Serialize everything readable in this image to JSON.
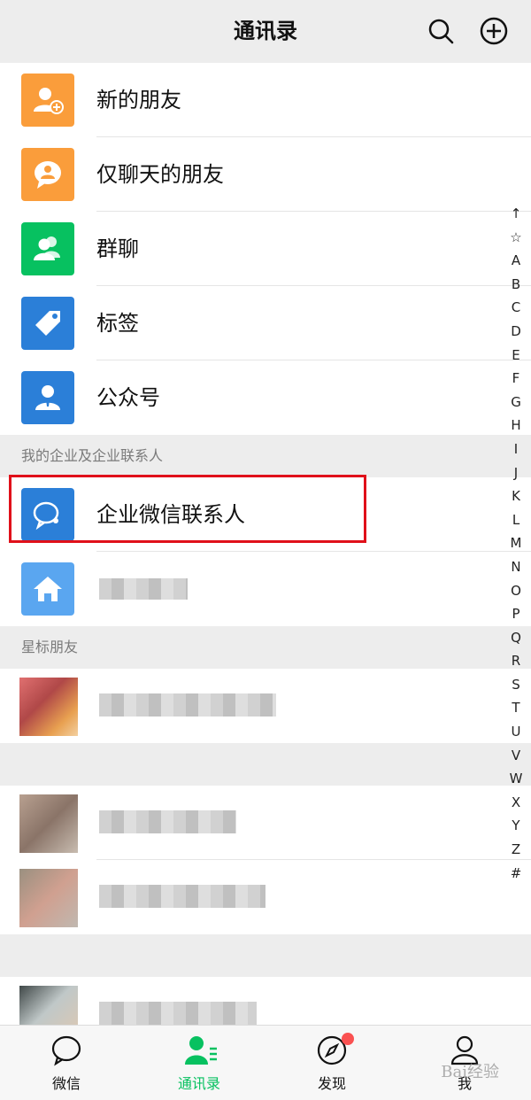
{
  "header": {
    "title": "通讯录",
    "search_icon": "search-icon",
    "add_icon": "plus-circle-icon"
  },
  "functions": [
    {
      "label": "新的朋友",
      "icon": "add-friend-icon",
      "color": "#fa9d3b"
    },
    {
      "label": "仅聊天的朋友",
      "icon": "chat-only-icon",
      "color": "#fa9d3b"
    },
    {
      "label": "群聊",
      "icon": "group-chat-icon",
      "color": "#07c160"
    },
    {
      "label": "标签",
      "icon": "tag-icon",
      "color": "#2b7fd8"
    },
    {
      "label": "公众号",
      "icon": "official-account-icon",
      "color": "#2b7fd8"
    }
  ],
  "enterprise": {
    "section_title": "我的企业及企业联系人",
    "items": [
      {
        "label": "企业微信联系人",
        "icon": "wecom-icon",
        "color": "#2b7fd8"
      }
    ]
  },
  "starred": {
    "section_title": "星标朋友"
  },
  "index_bar": [
    "↑",
    "☆",
    "A",
    "B",
    "C",
    "D",
    "E",
    "F",
    "G",
    "H",
    "I",
    "J",
    "K",
    "L",
    "M",
    "N",
    "O",
    "P",
    "Q",
    "R",
    "S",
    "T",
    "U",
    "V",
    "W",
    "X",
    "Y",
    "Z",
    "#"
  ],
  "tabs": [
    {
      "label": "微信",
      "icon": "chat-bubble-icon",
      "active": false
    },
    {
      "label": "通讯录",
      "icon": "contacts-icon",
      "active": true
    },
    {
      "label": "发现",
      "icon": "compass-icon",
      "active": false
    },
    {
      "label": "我",
      "icon": "person-icon",
      "active": false
    }
  ],
  "colors": {
    "accent": "#07c160",
    "highlight_box": "#e0101a",
    "badge": "#fa5151"
  },
  "watermark": "Bai经验"
}
